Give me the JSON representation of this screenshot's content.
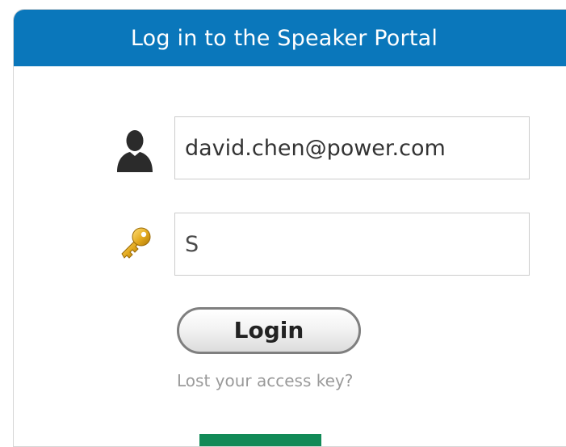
{
  "header": {
    "title": "Log in to the Speaker Portal"
  },
  "form": {
    "email_value": "david.chen@power.com",
    "password_visible_char": "S",
    "login_label": "Login",
    "lost_key_link": "Lost your access key?"
  },
  "icons": {
    "user": "user-silhouette-icon",
    "key": "key-icon"
  },
  "colors": {
    "header_bg": "#0a77bb",
    "header_text": "#ffffff",
    "redaction": "#118a57",
    "link_text": "#9a9a9a"
  }
}
